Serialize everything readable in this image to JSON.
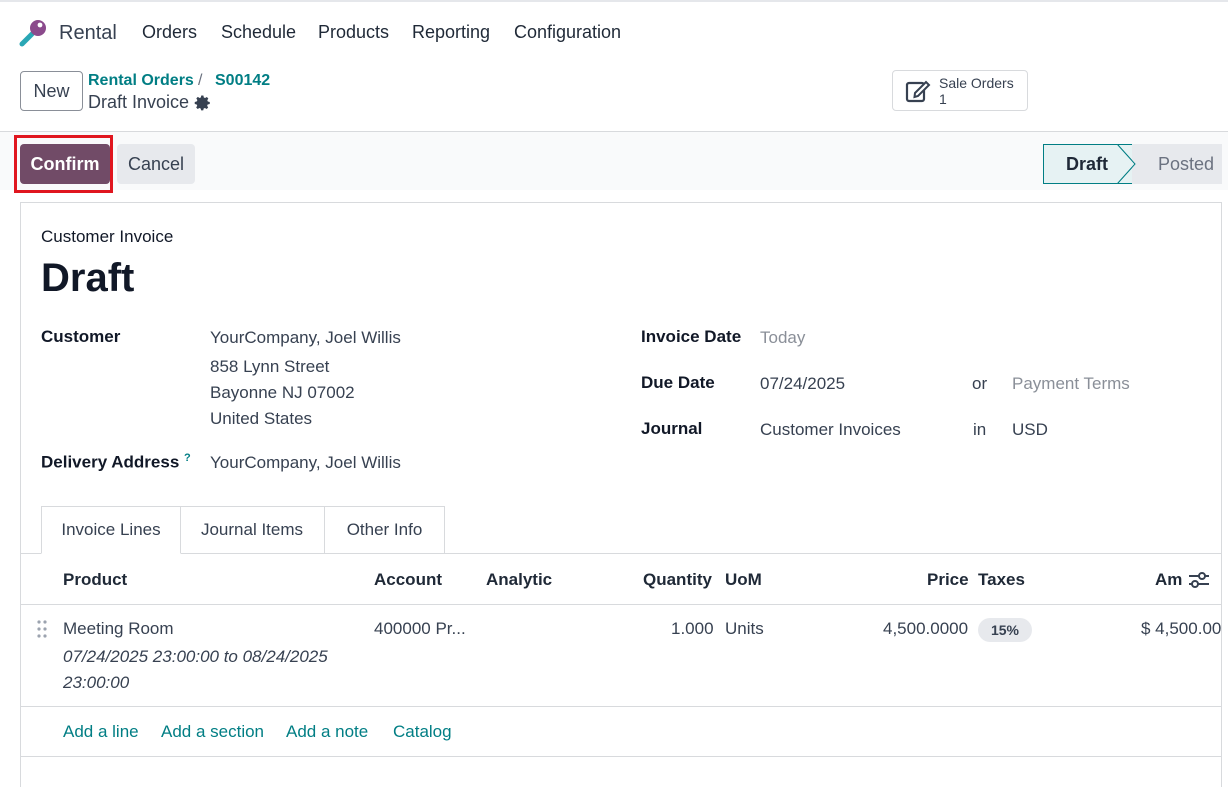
{
  "app": {
    "name": "Rental"
  },
  "nav": {
    "menus": [
      "Orders",
      "Schedule",
      "Products",
      "Reporting",
      "Configuration"
    ]
  },
  "control": {
    "new_label": "New",
    "breadcrumb": [
      "Rental Orders",
      "S00142"
    ],
    "breadcrumb_sep": "/",
    "record_name": "Draft Invoice"
  },
  "smart_button": {
    "label": "Sale Orders",
    "count": "1"
  },
  "actions": {
    "confirm_label": "Confirm",
    "cancel_label": "Cancel"
  },
  "statusbar": {
    "stages": [
      "Draft",
      "Posted"
    ],
    "active": "Draft"
  },
  "invoice": {
    "doc_type": "Customer Invoice",
    "title": "Draft",
    "customer_label": "Customer",
    "customer_name": "YourCompany, Joel Willis",
    "customer_address": [
      "858 Lynn Street",
      "Bayonne NJ 07002",
      "United States"
    ],
    "delivery_label": "Delivery Address",
    "delivery_help": "?",
    "delivery_value": "YourCompany, Joel Willis",
    "invoice_date_label": "Invoice Date",
    "invoice_date_placeholder": "Today",
    "due_date_label": "Due Date",
    "due_date_value": "07/24/2025",
    "or_label": "or",
    "payment_terms_placeholder": "Payment Terms",
    "journal_label": "Journal",
    "journal_value": "Customer Invoices",
    "in_label": "in",
    "currency_value": "USD"
  },
  "tabs": [
    "Invoice Lines",
    "Journal Items",
    "Other Info"
  ],
  "lines": {
    "headers": {
      "product": "Product",
      "account": "Account",
      "analytic": "Analytic",
      "quantity": "Quantity",
      "uom": "UoM",
      "price": "Price",
      "taxes": "Taxes",
      "amount": "Am"
    },
    "rows": [
      {
        "product": "Meeting Room",
        "description_1": "07/24/2025 23:00:00 to 08/24/2025",
        "description_2": "23:00:00",
        "account": "400000 Pr...",
        "quantity": "1.000",
        "uom": "Units",
        "price": "4,500.0000",
        "tax": "15%",
        "amount": "$ 4,500.00"
      }
    ],
    "add_links": [
      "Add a line",
      "Add a section",
      "Add a note",
      "Catalog"
    ]
  },
  "colors": {
    "primary": "#714b67",
    "link": "#017e84",
    "highlight": "#e0161f"
  }
}
